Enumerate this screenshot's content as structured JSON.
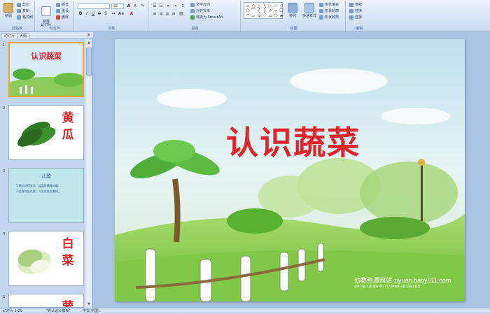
{
  "ribbon": {
    "clipboard": {
      "label": "剪贴板",
      "paste": "粘贴",
      "cut": "剪切",
      "copy": "复制",
      "format_painter": "格式刷"
    },
    "slides": {
      "label": "幻灯片",
      "new_slide": "新建\n幻灯片",
      "layout": "版式",
      "reset": "重设",
      "delete": "删除"
    },
    "font": {
      "label": "字体",
      "font_size": "32"
    },
    "paragraph": {
      "label": "段落",
      "text_direction": "文字方向",
      "align_text": "对齐文本",
      "smartart": "转换为 SmartArt"
    },
    "drawing": {
      "label": "绘图",
      "arrange": "排列",
      "quick_styles": "快速样式",
      "shape_fill": "形状填充",
      "shape_outline": "形状轮廓",
      "shape_effects": "形状效果"
    },
    "editing": {
      "label": "编辑",
      "find": "查找",
      "replace": "替换",
      "select": "选择"
    }
  },
  "panel": {
    "tab_slides": "幻灯片",
    "tab_outline": "大纲",
    "close": "×",
    "slides": [
      {
        "num": "1",
        "title": "认识蔬菜"
      },
      {
        "num": "2",
        "title": "黄瓜"
      },
      {
        "num": "3",
        "title": "儿歌",
        "line1": "1.黄瓜长得又长，盆盘排黄做瓜瓣，",
        "line2": "2.瓜胖瓜肚瓜胖，人瓜瓜肚瓜黄绿。"
      },
      {
        "num": "4",
        "title": "白菜"
      },
      {
        "num": "5",
        "title": "萝"
      }
    ]
  },
  "slide": {
    "title": "认识蔬菜",
    "watermark": "幼教资源网站 ziyuan.baby611.com",
    "watermark_sub": "课件下载  儿歌  故事MP3  FLASH课件下载  试卷下载等"
  },
  "status": {
    "slide_info": "幻灯片 1/29",
    "theme": "\"默认设计模板\"",
    "language": "中文(中国)"
  },
  "colors": {
    "title_red": "#e0242a",
    "ribbon_bg": "#d6e4f6",
    "selected_border": "#f0a030"
  }
}
